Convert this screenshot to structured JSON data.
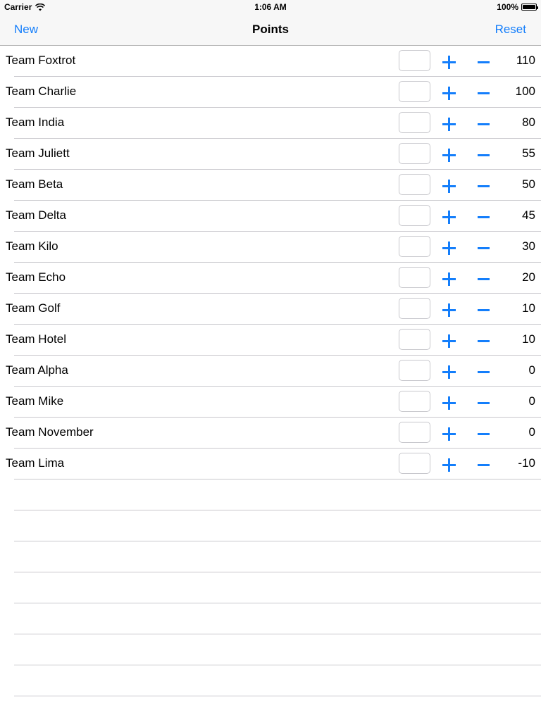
{
  "status_bar": {
    "carrier": "Carrier",
    "time": "1:06 AM",
    "battery": "100%"
  },
  "nav": {
    "left_label": "New",
    "title": "Points",
    "right_label": "Reset"
  },
  "colors": {
    "accent": "#147efb",
    "separator": "#c8c7cc"
  },
  "teams": [
    {
      "name": "Team Foxtrot",
      "points": "110"
    },
    {
      "name": "Team Charlie",
      "points": "100"
    },
    {
      "name": "Team India",
      "points": "80"
    },
    {
      "name": "Team Juliett",
      "points": "55"
    },
    {
      "name": "Team Beta",
      "points": "50"
    },
    {
      "name": "Team Delta",
      "points": "45"
    },
    {
      "name": "Team Kilo",
      "points": "30"
    },
    {
      "name": "Team Echo",
      "points": "20"
    },
    {
      "name": "Team Golf",
      "points": "10"
    },
    {
      "name": "Team Hotel",
      "points": "10"
    },
    {
      "name": "Team Alpha",
      "points": "0"
    },
    {
      "name": "Team Mike",
      "points": "0"
    },
    {
      "name": "Team November",
      "points": "0"
    },
    {
      "name": "Team Lima",
      "points": "-10"
    }
  ]
}
